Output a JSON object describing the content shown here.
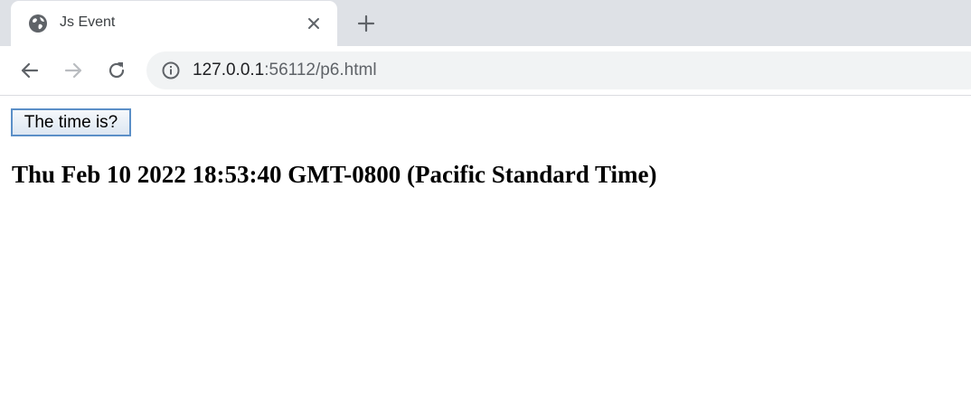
{
  "browser": {
    "tab": {
      "title": "Js Event",
      "favicon": "globe-icon",
      "close_icon": "close-icon"
    },
    "new_tab_icon": "plus-icon",
    "nav": {
      "back_icon": "arrow-left-icon",
      "forward_icon": "arrow-right-icon",
      "reload_icon": "reload-icon"
    },
    "address": {
      "info_icon": "info-icon",
      "host": "127.0.0.1",
      "rest": ":56112/p6.html"
    }
  },
  "page": {
    "button_label": "The time is?",
    "time_text": "Thu Feb 10 2022 18:53:40 GMT-0800 (Pacific Standard Time)"
  },
  "colors": {
    "tabstrip": "#dee1e6",
    "omnibox": "#f1f3f4",
    "button_border": "#5b8fc7"
  }
}
